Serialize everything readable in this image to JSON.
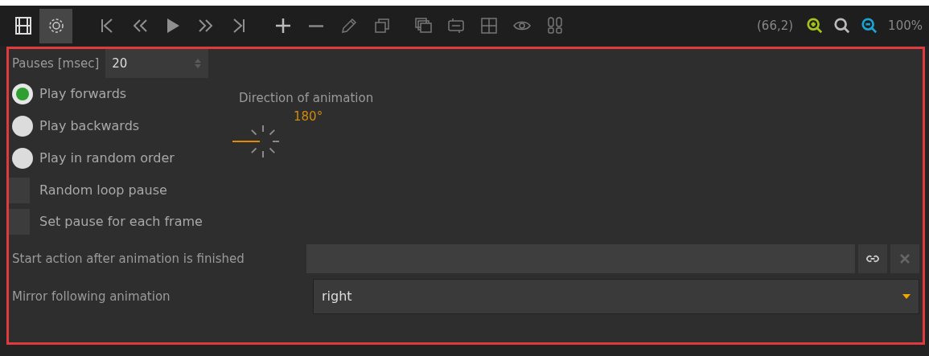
{
  "toolbar": {
    "items": [
      {
        "kind": "film",
        "selected": false
      },
      {
        "kind": "gear",
        "selected": true
      },
      {
        "kind": "first",
        "selected": false
      },
      {
        "kind": "rewind",
        "selected": false
      },
      {
        "kind": "play",
        "selected": false
      },
      {
        "kind": "forward",
        "selected": false
      },
      {
        "kind": "last",
        "selected": false
      },
      {
        "kind": "plus",
        "selected": false
      },
      {
        "kind": "minus",
        "selected": false
      },
      {
        "kind": "pencil",
        "selected": false
      },
      {
        "kind": "duplicate",
        "selected": false
      },
      {
        "kind": "layers",
        "selected": false
      },
      {
        "kind": "numbering",
        "selected": false
      },
      {
        "kind": "grid",
        "selected": false
      },
      {
        "kind": "eye",
        "selected": false
      },
      {
        "kind": "footprints",
        "selected": false
      }
    ],
    "coordinates": "(66,2)",
    "zoom_buttons": [
      {
        "kind": "zoom-in"
      },
      {
        "kind": "zoom-fit"
      },
      {
        "kind": "zoom-out"
      }
    ],
    "zoom": "100%"
  },
  "pauses": {
    "label": "Pauses [msec]",
    "value": "20"
  },
  "play_modes": [
    {
      "label": "Play forwards",
      "selected": true
    },
    {
      "label": "Play backwards",
      "selected": false
    },
    {
      "label": "Play in random order",
      "selected": false
    }
  ],
  "direction": {
    "label": "Direction of animation",
    "reading": "180°",
    "ticks": [
      {
        "selected": false
      },
      {
        "selected": false
      },
      {
        "selected": false
      },
      {
        "selected": false
      },
      {
        "selected": false
      },
      {
        "selected": false
      },
      {
        "selected": true
      },
      {
        "selected": false
      }
    ]
  },
  "options": [
    {
      "label": "Random loop pause",
      "checked": false
    },
    {
      "label": "Set pause for each frame",
      "checked": false
    }
  ],
  "start_action": {
    "label": "Start action after animation is finished"
  },
  "mirror": {
    "label": "Mirror following animation",
    "value": "right"
  }
}
